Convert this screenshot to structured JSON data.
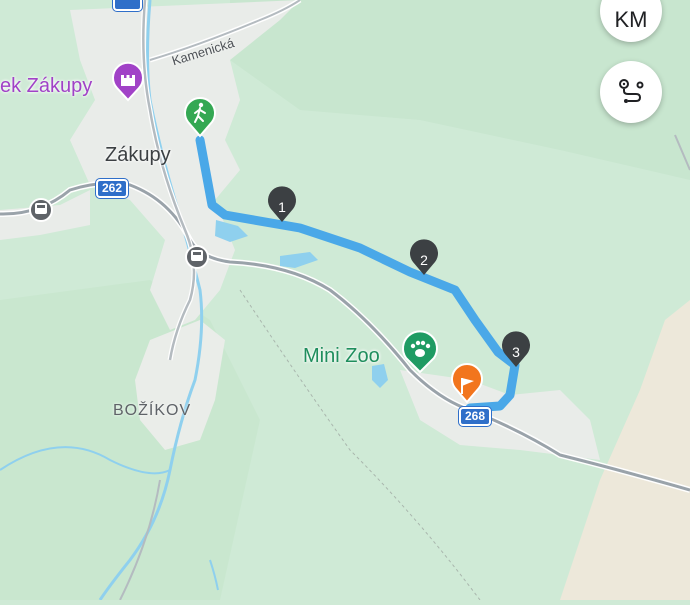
{
  "map": {
    "colors": {
      "land": "#cfead6",
      "route": "#4aa8e8",
      "settlement": "#eef0ee",
      "water": "#8fd0ee",
      "road": "#9aa3aa"
    },
    "labels": {
      "castle_poi": "ek Zákupy",
      "town": "Zákupy",
      "street": "Kamenická",
      "village": "BOŽÍKOV",
      "zoo_poi": "Mini Zoo"
    },
    "road_shields": {
      "r262": "262",
      "r268": "268"
    },
    "waypoints": [
      {
        "label": "1"
      },
      {
        "label": "2"
      },
      {
        "label": "3"
      }
    ],
    "markers": {
      "start": {
        "icon": "hiking-icon",
        "color": "#34a853"
      },
      "finish": {
        "icon": "flag-icon",
        "color": "#f2751d"
      },
      "castle": {
        "icon": "castle-icon",
        "color": "#a142c7"
      },
      "zoo": {
        "icon": "paw-icon",
        "color": "#1f9b63"
      },
      "train_stations": {
        "icon": "train-icon",
        "count": 2
      }
    }
  },
  "controls": {
    "units_button": {
      "label": "KM"
    },
    "route_button": {
      "icon": "route-icon"
    }
  }
}
